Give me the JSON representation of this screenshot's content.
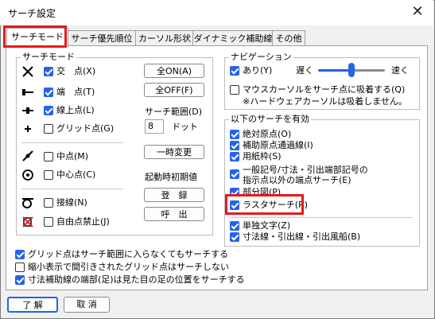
{
  "window": {
    "title": "サーチ設定",
    "close_label": "✕"
  },
  "tabs": [
    {
      "label": "サーチモード",
      "active": true
    },
    {
      "label": "サーチ優先順位"
    },
    {
      "label": "カーソル形状"
    },
    {
      "label": "ダイナミック補助線"
    },
    {
      "label": "その他"
    }
  ],
  "search_mode": {
    "group_title": "サーチモード",
    "items": [
      {
        "label": "交　点(X)",
        "checked": true,
        "icon": "intersection-icon"
      },
      {
        "label": "端　点(T)",
        "checked": true,
        "icon": "endpoint-icon"
      },
      {
        "label": "線上点(L)",
        "checked": true,
        "icon": "on-line-point-icon"
      },
      {
        "label": "グリッド点(G)",
        "checked": false,
        "icon": "grid-point-icon"
      },
      {
        "label": "中点(M)",
        "checked": false,
        "icon": "midpoint-icon"
      },
      {
        "label": "中心点(C)",
        "checked": false,
        "icon": "center-point-icon"
      },
      {
        "label": "接線(N)",
        "checked": false,
        "icon": "tangent-icon"
      },
      {
        "label": "自由点禁止(J)",
        "checked": false,
        "icon": "free-point-prohibited-icon"
      }
    ],
    "all_on_label": "全ON(A)",
    "all_off_label": "全OFF(F)",
    "range_label": "サーチ範囲(D)",
    "range_value": "8",
    "range_unit": "ドット",
    "temp_change_label": "一時変更",
    "startup_label": "起動時初期値",
    "register_label": "登　録",
    "recall_label": "呼　出"
  },
  "navigation": {
    "group_title": "ナビゲーション",
    "enabled_label": "あり(Y)",
    "enabled_checked": true,
    "slow_label": "遅く",
    "fast_label": "速く",
    "speed_fraction": 0.5,
    "attract_label_1": "マウスカーソルをサーチ点に吸着する(Q)",
    "attract_label_2": "※ハードウェアカーソルは吸着しません。",
    "attract_checked": false
  },
  "enable_group": {
    "group_title": "以下のサーチを有効",
    "items": [
      {
        "label": "絶対原点(O)",
        "checked": true
      },
      {
        "label": "補助原点通過線(I)",
        "checked": true
      },
      {
        "label": "用紙枠(S)",
        "checked": true
      },
      {
        "label": "一般記号/寸法・引出端部記号の",
        "label2": "指示点以外の端点サーチ(E)",
        "checked": true
      },
      {
        "label": "部分図(P)",
        "checked": true
      },
      {
        "label": "ラスタサーチ(R)",
        "checked": true
      },
      {
        "label": "単独文字(Z)",
        "checked": true
      },
      {
        "label": "寸法線・引出線・引出風船(B)",
        "checked": true
      }
    ]
  },
  "bottom_options": [
    {
      "label": "グリッド点はサーチ範囲に入らなくてもサーチする",
      "checked": true
    },
    {
      "label": "縮小表示で間引きされたグリッド点はサーチしない",
      "checked": false
    },
    {
      "label": "寸法補助線の端部(足)は見た目の足の位置をサーチする",
      "checked": true
    }
  ],
  "footer": {
    "ok_label": "了 解",
    "cancel_label": "取 消"
  }
}
